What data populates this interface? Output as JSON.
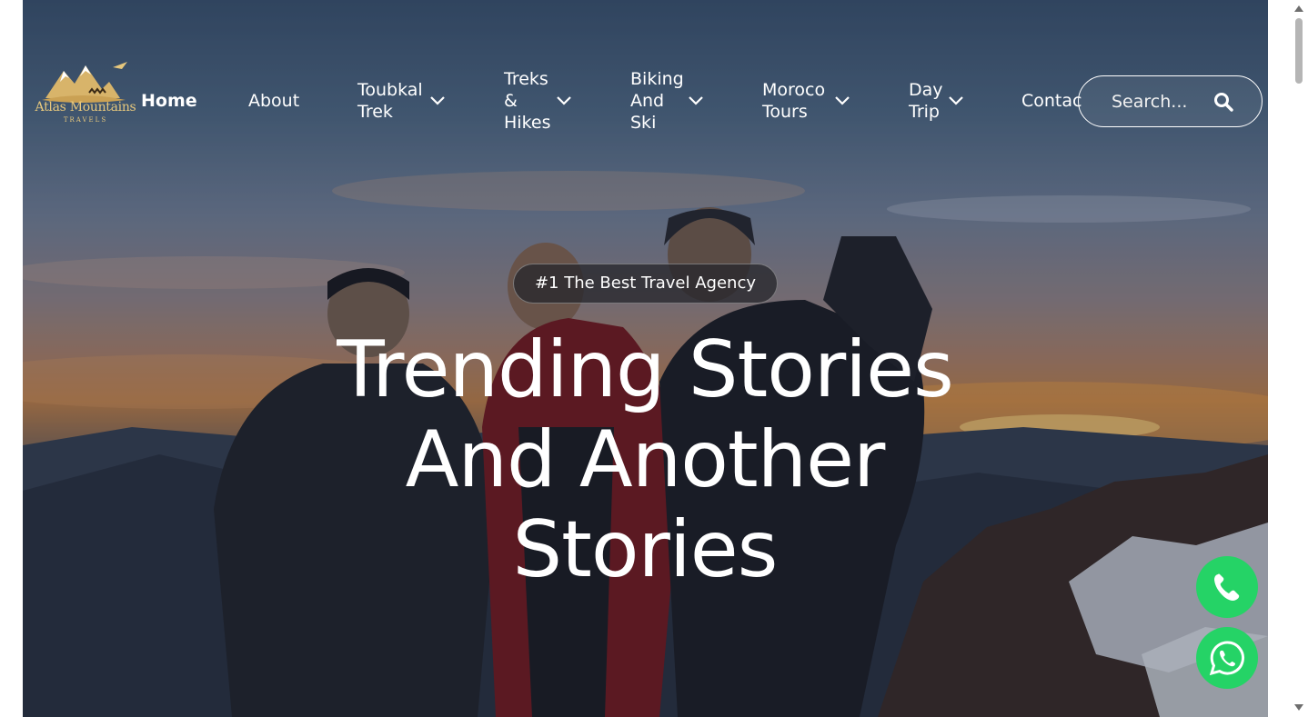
{
  "brand": {
    "name": "Atlas Mountains",
    "sub": "TRAVELS"
  },
  "nav": {
    "items": [
      {
        "label": "Home"
      },
      {
        "label": "About"
      },
      {
        "label": "Toubkal\nTrek"
      },
      {
        "label": "Treks\n&\nHikes"
      },
      {
        "label": "Biking\nAnd\nSki"
      },
      {
        "label": "Moroco\nTours"
      },
      {
        "label": "Day\nTrip"
      },
      {
        "label": "Contac"
      }
    ]
  },
  "search": {
    "placeholder": "Search..."
  },
  "hero": {
    "badge": "#1 The Best Travel Agency",
    "headline_lines": [
      "Trending Stories",
      "And Another",
      "Stories"
    ]
  },
  "fabs": {
    "phone": "phone-icon",
    "whatsapp": "whatsapp-icon"
  },
  "colors": {
    "accent_green": "#25d366",
    "logo_gold": "#e6c77d"
  }
}
